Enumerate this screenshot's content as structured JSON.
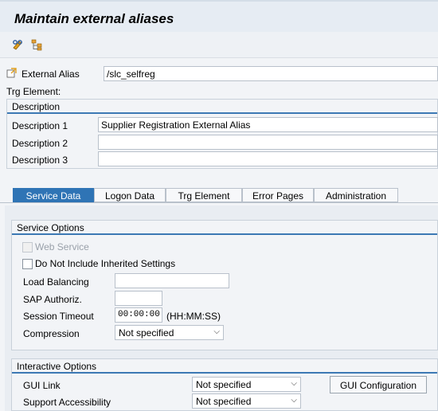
{
  "window": {
    "title": "Maintain external aliases"
  },
  "toolbar": {
    "edit_icon": "pencil-glasses-icon",
    "tree_icon": "hierarchy-icon"
  },
  "alias": {
    "label": "External Alias",
    "value": "/slc_selfreg",
    "icon": "alias-icon"
  },
  "trg_element": {
    "label": "Trg Element:"
  },
  "description": {
    "title": "Description",
    "rows": [
      {
        "label": "Description 1",
        "value": "Supplier Registration External Alias"
      },
      {
        "label": "Description 2",
        "value": ""
      },
      {
        "label": "Description 3",
        "value": ""
      }
    ]
  },
  "tabs": [
    {
      "label": "Service Data",
      "active": true
    },
    {
      "label": "Logon Data",
      "active": false
    },
    {
      "label": "Trg Element",
      "active": false
    },
    {
      "label": "Error Pages",
      "active": false
    },
    {
      "label": "Administration",
      "active": false
    }
  ],
  "service_options": {
    "title": "Service Options",
    "web_service": {
      "label": "Web Service",
      "checked": false,
      "enabled": false
    },
    "no_inherit": {
      "label": "Do Not Include Inherited Settings",
      "checked": false
    },
    "load_balancing": {
      "label": "Load Balancing",
      "value": ""
    },
    "sap_authoriz": {
      "label": "SAP Authoriz.",
      "value": ""
    },
    "session_timeout": {
      "label": "Session Timeout",
      "value": "00:00:00",
      "format": "(HH:MM:SS)"
    },
    "compression": {
      "label": "Compression",
      "value": "Not specified"
    }
  },
  "interactive_options": {
    "title": "Interactive Options",
    "gui_link": {
      "label": "GUI Link",
      "value": "Not specified"
    },
    "support_accessibility": {
      "label": "Support Accessibility",
      "value": "Not specified"
    },
    "gui_config_button": "GUI Configuration"
  },
  "colors": {
    "accent": "#2f74b5",
    "group_underline": "#3c79b4"
  }
}
